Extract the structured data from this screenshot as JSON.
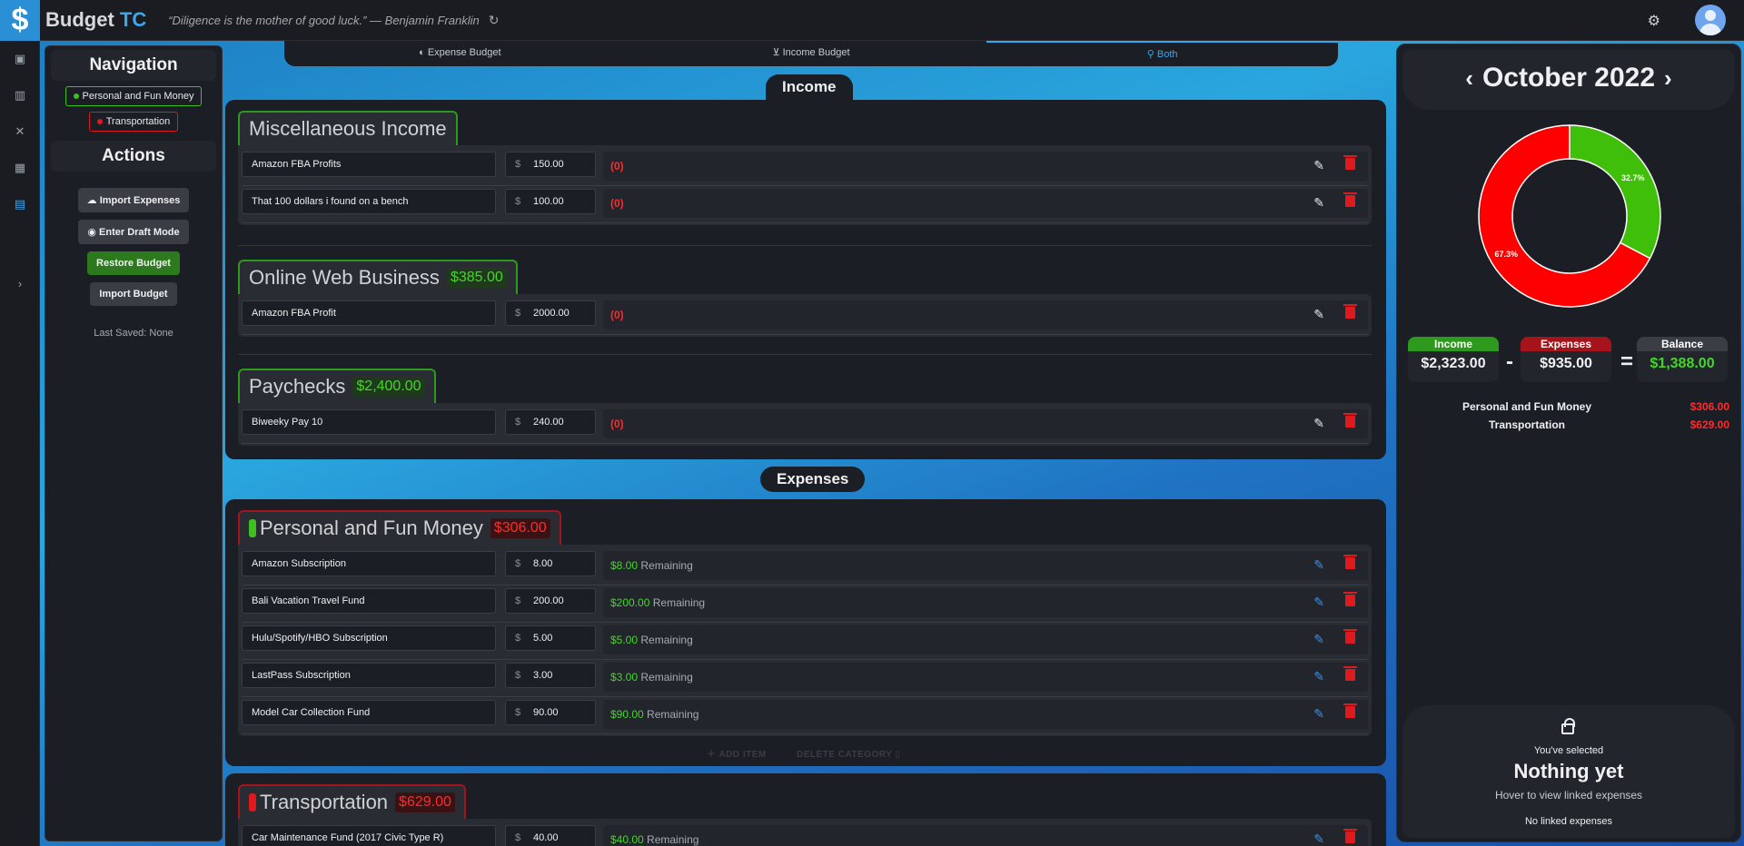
{
  "header": {
    "logo_glyph": "$",
    "brand_main": "Budget",
    "brand_accent": "TC",
    "quote": "“Diligence is the mother of good luck.” — Benjamin Franklin",
    "icons": [
      "refresh-icon",
      "gear-icon",
      "avatar"
    ]
  },
  "rail": {
    "icons": [
      "dashboard-icon",
      "bar-chart-icon",
      "tools-icon",
      "calendar-icon",
      "table-icon",
      "expand-chevron-icon"
    ]
  },
  "navigation": {
    "title": "Navigation",
    "items": [
      {
        "label": "Personal and Fun Money",
        "color": "#3fbf1f"
      },
      {
        "label": "Transportation",
        "color": "#e0191f"
      }
    ],
    "actions_title": "Actions",
    "actions": [
      "Import Expenses",
      "Enter Draft Mode",
      "Restore Budget",
      "Import Budget"
    ],
    "last_saved": "Last Saved: None"
  },
  "tabs": [
    {
      "label": "Expense Budget",
      "active": false
    },
    {
      "label": "Income Budget",
      "active": false
    },
    {
      "label": "Both",
      "active": true
    }
  ],
  "income": {
    "title": "Income",
    "categories": [
      {
        "name": "Miscellaneous Income",
        "amount": "",
        "rows": [
          {
            "name": "Amazon FBA Profits",
            "value": "150.00",
            "status": "(0)"
          },
          {
            "name": "That 100 dollars i found on a bench",
            "value": "100.00",
            "status": "(0)"
          }
        ]
      },
      {
        "name": "Online Web Business",
        "amount": "$385.00",
        "rows": [
          {
            "name": "Amazon FBA Profit",
            "value": "2000.00",
            "status": "(0)"
          }
        ]
      },
      {
        "name": "Paychecks",
        "amount": "$2,400.00",
        "rows": [
          {
            "name": "Biweeky Pay 10",
            "value": "240.00",
            "status": "(0)"
          }
        ]
      }
    ]
  },
  "expenses": {
    "title": "Expenses",
    "categories": [
      {
        "name": "Personal and Fun Money",
        "amount": "$306.00",
        "color": "#3fbf1f",
        "rows": [
          {
            "name": "Amazon Subscription",
            "value": "8.00",
            "remaining": "$8.00",
            "remaining_label": "Remaining"
          },
          {
            "name": "Bali Vacation Travel Fund",
            "value": "200.00",
            "remaining": "$200.00",
            "remaining_label": "Remaining"
          },
          {
            "name": "Hulu/Spotify/HBO Subscription",
            "value": "5.00",
            "remaining": "$5.00",
            "remaining_label": "Remaining"
          },
          {
            "name": "LastPass Subscription",
            "value": "3.00",
            "remaining": "$3.00",
            "remaining_label": "Remaining"
          },
          {
            "name": "Model Car Collection Fund",
            "value": "90.00",
            "remaining": "$90.00",
            "remaining_label": "Remaining"
          }
        ],
        "add_item": "ADD ITEM",
        "delete_category": "DELETE CATEGORY"
      },
      {
        "name": "Transportation",
        "amount": "$629.00",
        "color": "#e0191f",
        "rows": [
          {
            "name": "Car Maintenance Fund (2017 Civic Type R)",
            "value": "40.00",
            "remaining": "$40.00",
            "remaining_label": "Remaining"
          }
        ]
      }
    ]
  },
  "summary": {
    "month": "October 2022",
    "chart_data": {
      "type": "pie",
      "categories": [
        "Transportation",
        "Personal and Fun Money"
      ],
      "values": [
        67.3,
        32.7
      ],
      "labels": [
        "67.3%",
        "32.7%"
      ],
      "colors": [
        "#ff0000",
        "#3fbf0a"
      ]
    },
    "income_label": "Income",
    "income_value": "$2,323.00",
    "expenses_label": "Expenses",
    "expenses_value": "$935.00",
    "balance_label": "Balance",
    "balance_value": "$1,388.00",
    "minus": "-",
    "equals": "=",
    "breakdown": [
      {
        "name": "Personal and Fun Money",
        "value": "$306.00"
      },
      {
        "name": "Transportation",
        "value": "$629.00"
      }
    ],
    "linked": {
      "selected": "You've selected",
      "nothing": "Nothing yet",
      "hover": "Hover to view linked expenses",
      "none": "No linked expenses"
    }
  }
}
